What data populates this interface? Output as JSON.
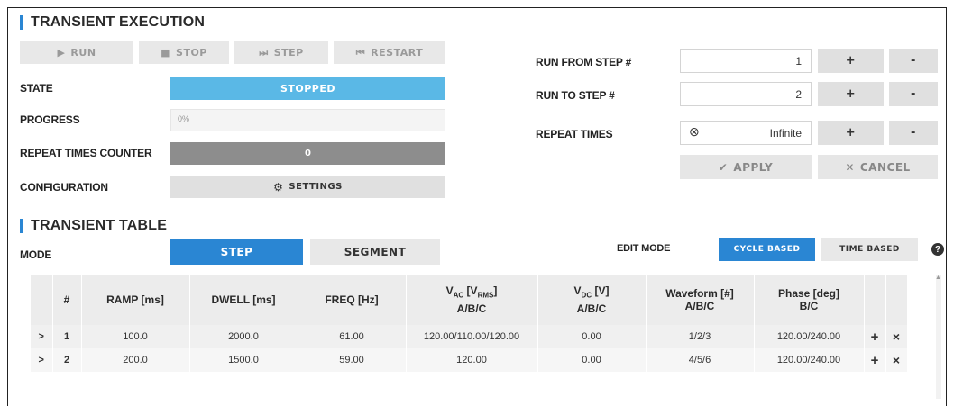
{
  "execution": {
    "title": "TRANSIENT EXECUTION",
    "buttons": {
      "run": "RUN",
      "stop": "STOP",
      "step": "STEP",
      "restart": "RESTART"
    },
    "icons": {
      "run": "▶",
      "stop": "■",
      "step": "⏭",
      "restart": "⏮"
    },
    "state_label": "STATE",
    "state_value": "STOPPED",
    "progress_label": "PROGRESS",
    "progress_value": "0%",
    "progress_fraction": 0,
    "repeat_counter_label": "REPEAT TIMES COUNTER",
    "repeat_counter_value": "0",
    "configuration_label": "CONFIGURATION",
    "settings_button": "SETTINGS",
    "settings_icon": "gear-icon"
  },
  "run_settings": {
    "run_from_label": "RUN FROM STEP #",
    "run_from_value": "1",
    "run_to_label": "RUN TO STEP #",
    "run_to_value": "2",
    "repeat_label": "REPEAT TIMES",
    "repeat_value": "Infinite",
    "plus": "+",
    "minus": "-",
    "apply_button": "APPLY",
    "cancel_button": "CANCEL"
  },
  "table_section": {
    "title": "TRANSIENT TABLE",
    "mode_label": "MODE",
    "mode_step": "STEP",
    "mode_segment": "SEGMENT",
    "edit_mode_label": "EDIT MODE",
    "edit_cycle": "CYCLE BASED",
    "edit_time": "TIME BASED",
    "help_icon": "?"
  },
  "table": {
    "headers": {
      "num": "#",
      "ramp": "RAMP [ms]",
      "dwell": "DWELL [ms]",
      "freq": "FREQ [Hz]",
      "vac_v": "V",
      "vac_sub": "AC",
      "vac_mid": " [V",
      "vac_sub2": "RMS",
      "vac_end": "]",
      "vac_line2": "A/B/C",
      "vdc_v": "V",
      "vdc_sub": "DC",
      "vdc_end": " [V]",
      "vdc_line2": "A/B/C",
      "wave_line1": "Waveform [#]",
      "wave_line2": "A/B/C",
      "phase_line1": "Phase [deg]",
      "phase_line2": "B/C"
    },
    "rows": [
      {
        "expand": ">",
        "num": "1",
        "ramp": "100.0",
        "dwell": "2000.0",
        "freq": "61.00",
        "vac": "120.00/110.00/120.00",
        "vdc": "0.00",
        "wave": "1/2/3",
        "phase": "120.00/240.00",
        "add": "+",
        "del": "×"
      },
      {
        "expand": ">",
        "num": "2",
        "ramp": "200.0",
        "dwell": "1500.0",
        "freq": "59.00",
        "vac": "120.00",
        "vdc": "0.00",
        "wave": "4/5/6",
        "phase": "120.00/240.00",
        "add": "+",
        "del": "×"
      }
    ]
  },
  "colors": {
    "accent": "#2a86d3",
    "state_blue": "#5ab8e6",
    "counter_gray": "#8d8d8d"
  }
}
